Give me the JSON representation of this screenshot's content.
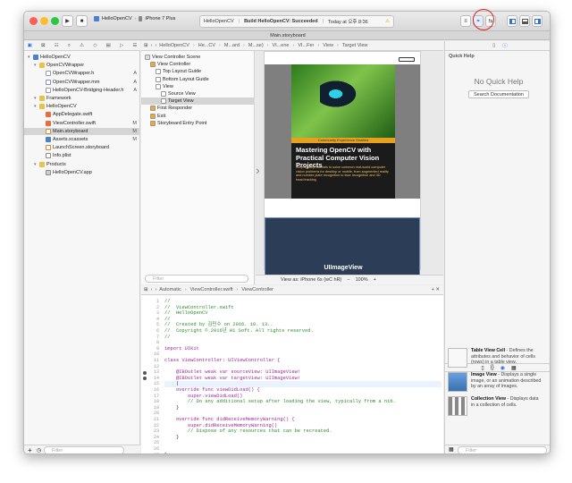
{
  "toolbar": {
    "scheme": "HelloOpenCV",
    "device": "iPhone 7 Plus",
    "status_project": "HelloOpenCV",
    "status_build": "Build HelloOpenCV: Succeeded",
    "status_time": "Today at 오후 8:36"
  },
  "editor_title": "Main.storyboard",
  "navigator": {
    "items": [
      {
        "label": "HelloOpenCV",
        "icon": "project-icon",
        "indent": 0,
        "status": ""
      },
      {
        "label": "OpenCVWrapper",
        "icon": "folder-icon",
        "indent": 1,
        "status": ""
      },
      {
        "label": "OpenCVWrapper.h",
        "icon": "header-file-icon",
        "indent": 2,
        "status": "A"
      },
      {
        "label": "OpenCVWrapper.mm",
        "icon": "objc-file-icon",
        "indent": 2,
        "status": "A"
      },
      {
        "label": "HelloOpenCV-Bridging-Header.h",
        "icon": "header-file-icon",
        "indent": 2,
        "status": "A"
      },
      {
        "label": "Framework",
        "icon": "folder-icon",
        "indent": 1,
        "status": ""
      },
      {
        "label": "HelloOpenCV",
        "icon": "folder-icon",
        "indent": 1,
        "status": ""
      },
      {
        "label": "AppDelegate.swift",
        "icon": "swift-file-icon",
        "indent": 2,
        "status": ""
      },
      {
        "label": "ViewController.swift",
        "icon": "swift-file-icon",
        "indent": 2,
        "status": "M"
      },
      {
        "label": "Main.storyboard",
        "icon": "storyboard-file-icon",
        "indent": 2,
        "status": "M"
      },
      {
        "label": "Assets.xcassets",
        "icon": "assets-icon",
        "indent": 2,
        "status": "M"
      },
      {
        "label": "LaunchScreen.storyboard",
        "icon": "storyboard-file-icon",
        "indent": 2,
        "status": ""
      },
      {
        "label": "Info.plist",
        "icon": "plist-file-icon",
        "indent": 2,
        "status": ""
      },
      {
        "label": "Products",
        "icon": "folder-icon",
        "indent": 1,
        "status": ""
      },
      {
        "label": "HelloOpenCV.app",
        "icon": "app-icon",
        "indent": 2,
        "status": ""
      }
    ],
    "filter_placeholder": "Filter"
  },
  "jumpbar_top": [
    "HelloOpenCV",
    "He...CV",
    "M...ard",
    "M...se)",
    "VI...ene",
    "VI...Fer",
    "View",
    "Target View"
  ],
  "outline": {
    "items": [
      {
        "label": "View Controller Scene",
        "indent": 0
      },
      {
        "label": "View Controller",
        "indent": 1
      },
      {
        "label": "Top Layout Guide",
        "indent": 2
      },
      {
        "label": "Bottom Layout Guide",
        "indent": 2
      },
      {
        "label": "View",
        "indent": 2
      },
      {
        "label": "Source View",
        "indent": 3
      },
      {
        "label": "Target View",
        "indent": 3
      },
      {
        "label": "First Responder",
        "indent": 1
      },
      {
        "label": "Exit",
        "indent": 1
      },
      {
        "label": "Storyboard Entry Point",
        "indent": 1
      }
    ],
    "filter_placeholder": "Filter"
  },
  "canvas": {
    "book_banner": "Community Experience Distilled",
    "book_title": "Mastering OpenCV with Practical Computer Vision Projects",
    "book_desc": "Step-by-step tutorials to solve common real-world computer vision problems for desktop or mobile, from augmented reality and number plate recognition to face recognition and 3D head tracking",
    "target_label": "UIImageView",
    "view_as": "View as: iPhone 6s (wC hR)",
    "zoom": "100%"
  },
  "code_jumpbar": [
    "Automatic",
    "ViewController.swift",
    "ViewController"
  ],
  "code": {
    "line_numbers": [
      "1",
      "2",
      "3",
      "4",
      "5",
      "6",
      "7",
      "8",
      "9",
      "10",
      "11",
      "12",
      "13",
      "14",
      "15",
      "16",
      "17",
      "18",
      "19",
      "20",
      "21",
      "22",
      "23",
      "24",
      "25",
      "26",
      "27",
      "28"
    ],
    "lines": [
      "//",
      "//  ViewController.swift",
      "//  HelloOpenCV",
      "//",
      "//  Created by 김민수 on 2016. 10. 13..",
      "//  Copyright © 2016년 H1 Soft. All rights reserved.",
      "//",
      "",
      "import UIKit",
      "",
      "class ViewController: UIViewController {",
      "",
      "    @IBOutlet weak var sourceView: UIImageView!",
      "    @IBOutlet weak var targetView: UIImageView!",
      "    |",
      "    override func viewDidLoad() {",
      "        super.viewDidLoad()",
      "        // Do any additional setup after loading the view, typically from a nib.",
      "    }",
      "",
      "    override func didReceiveMemoryWarning() {",
      "        super.didReceiveMemoryWarning()",
      "        // Dispose of any resources that can be recreated.",
      "    }",
      "",
      "",
      "}",
      ""
    ]
  },
  "inspector": {
    "title": "Quick Help",
    "no_help": "No Quick Help",
    "search_button": "Search Documentation"
  },
  "library": {
    "items": [
      {
        "title": "Table View Cell",
        "desc": " - Defines the attributes and behavior of cells (rows) in a table view."
      },
      {
        "title": "Image View",
        "desc": " - Displays a single image, or an animation described by an array of images."
      },
      {
        "title": "Collection View",
        "desc": " - Displays data in a collection of cells."
      }
    ],
    "filter_placeholder": "Filter"
  },
  "colors": {
    "accent": "#2f6fe0",
    "annotation": "#e02020",
    "target_view": "#2c3e57"
  }
}
